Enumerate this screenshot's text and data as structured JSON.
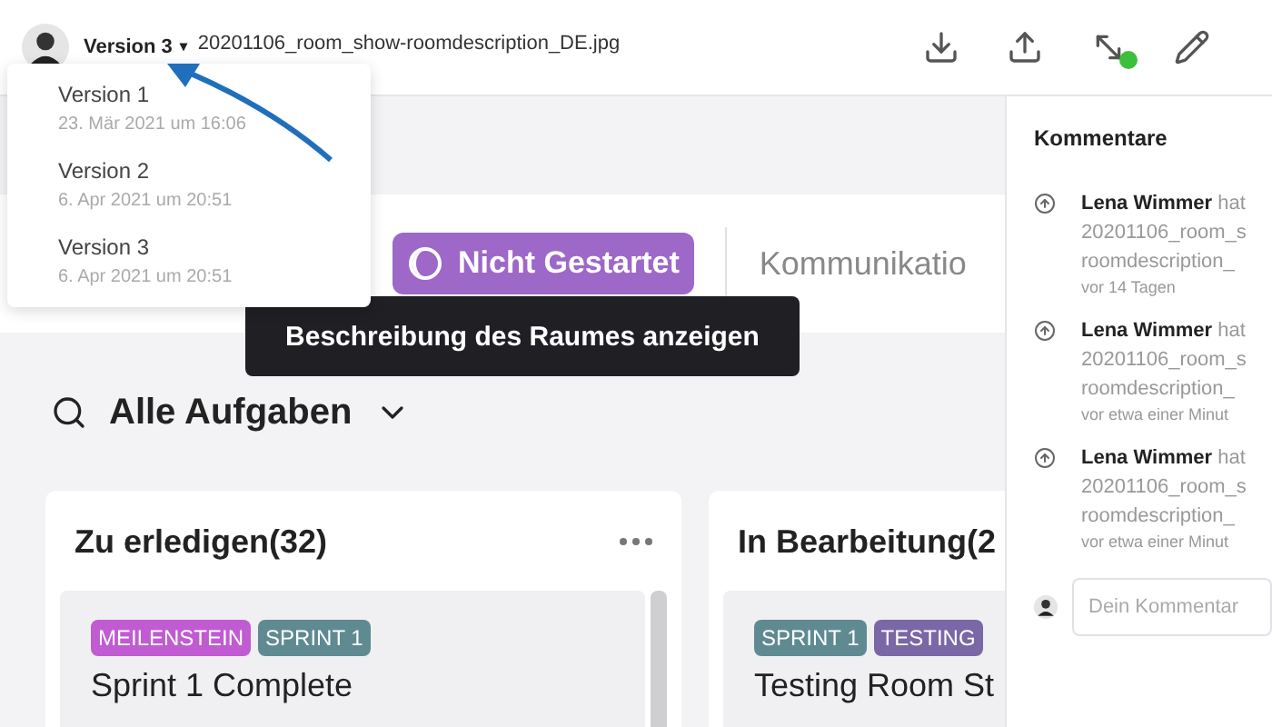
{
  "header": {
    "version_button": "Version 3",
    "caret": "▾",
    "filename": "20201106_room_show-roomdescription_DE.jpg",
    "tools": [
      {
        "kind": "download"
      },
      {
        "kind": "upload"
      },
      {
        "kind": "resize",
        "online": true
      },
      {
        "kind": "edit"
      }
    ]
  },
  "version_menu": [
    {
      "label": "Version 1",
      "date": "23. Mär 2021 um 16:06"
    },
    {
      "label": "Version 2",
      "date": "6. Apr 2021 um 20:51"
    },
    {
      "label": "Version 3",
      "date": "6. Apr 2021 um 20:51"
    }
  ],
  "status_button": "Nicht Gestartet",
  "tab": "Kommunikatio",
  "tooltip": "Beschreibung des Raumes anzeigen",
  "filter": "Alle Aufgaben",
  "columns": [
    {
      "title": "Zu erledigen(32)",
      "menu": true,
      "cards": [
        {
          "title": "Sprint 1 Complete",
          "tags": [
            {
              "label": "MEILENSTEIN",
              "color": "#c05bd2"
            },
            {
              "label": "SPRINT 1",
              "color": "#5f8a92"
            }
          ]
        }
      ]
    },
    {
      "title": "In Bearbeitung(2",
      "menu": false,
      "cards": [
        {
          "title": "Testing Room St",
          "tags": [
            {
              "label": "SPRINT 1",
              "color": "#5f8a92"
            },
            {
              "label": "TESTING",
              "color": "#7a67a6"
            }
          ]
        }
      ]
    }
  ],
  "comments": {
    "title": "Kommentare",
    "items": [
      {
        "author": "Lena Wimmer",
        "action": "hat",
        "lines": [
          "20201106_room_s",
          "roomdescription_"
        ],
        "time": "vor 14 Tagen"
      },
      {
        "author": "Lena Wimmer",
        "action": "hat",
        "lines": [
          "20201106_room_s",
          "roomdescription_"
        ],
        "time": "vor etwa einer Minut"
      },
      {
        "author": "Lena Wimmer",
        "action": "hat",
        "lines": [
          "20201106_room_s",
          "roomdescription_"
        ],
        "time": "vor etwa einer Minut"
      }
    ],
    "input": {
      "placeholder": "Dein Kommentar"
    }
  }
}
